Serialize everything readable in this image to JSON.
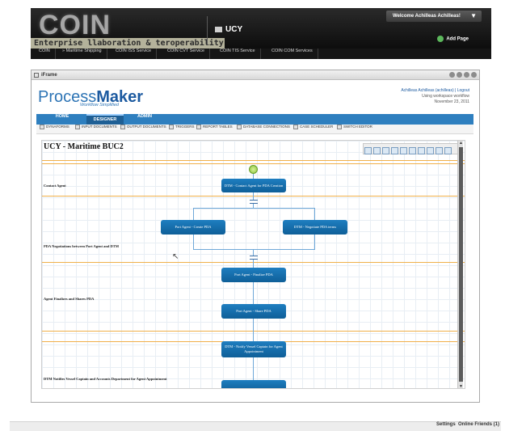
{
  "header": {
    "logo_text": "COIN",
    "logo_subtitle": "Enterprise  llaboration &  teroperability",
    "org": "UCY",
    "welcome": "Welcome Achilleas Achilleas!",
    "add_page": "Add Page"
  },
  "nav": {
    "items": [
      {
        "label": "COIN"
      },
      {
        "label": "» Maritime Shipping"
      },
      {
        "label": "COIN ISS Service"
      },
      {
        "label": "COIN CVT Service"
      },
      {
        "label": "COIN TIS Service"
      },
      {
        "label": "COIN COM Services"
      }
    ]
  },
  "window": {
    "title": "iFrame"
  },
  "pm": {
    "logo_a": "Process",
    "logo_b": "Maker",
    "tagline": "Workflow Simplified",
    "user_line": "Achilleas Achilleas (achilleas) | Logout",
    "workspace": "Using workspace workflow",
    "date": "November 23, 2011"
  },
  "tabs": [
    {
      "label": "HOME"
    },
    {
      "label": "DESIGNER"
    },
    {
      "label": "ADMIN"
    }
  ],
  "toolbar": [
    {
      "label": "DYNAFORMS"
    },
    {
      "label": "INPUT DOCUMENTS"
    },
    {
      "label": "OUTPUT DOCUMENTS"
    },
    {
      "label": "TRIGGERS"
    },
    {
      "label": "REPORT TABLES"
    },
    {
      "label": "DATABASE CONNECTIONS"
    },
    {
      "label": "CASE SCHEDULER"
    },
    {
      "label": "SWITCH EDITOR"
    }
  ],
  "process": {
    "title": "UCY - Maritime BUC2",
    "lanes": [
      {
        "label": "Contact Agent"
      },
      {
        "label": "PDA Negotiations between Port Agent and DTM"
      },
      {
        "label": "Agent Finalizes and Shares PDA"
      },
      {
        "label": "DTM Notifies Vessel Captain and Accounts Department for Agent Appointment"
      }
    ],
    "tasks": [
      {
        "label": "DTM - Contact Agent for PDA Creation"
      },
      {
        "label": "Port Agent - Create PDA"
      },
      {
        "label": "DTM - Negotiate PDA terms"
      },
      {
        "label": "Port Agent - Finalize PDA"
      },
      {
        "label": "Port Agent - Share PDA"
      },
      {
        "label": "DTM - Notify Vessel Captain for Agent Appointment"
      }
    ]
  },
  "footer": {
    "settings": "Settings",
    "friends": "Online Friends (1)"
  }
}
